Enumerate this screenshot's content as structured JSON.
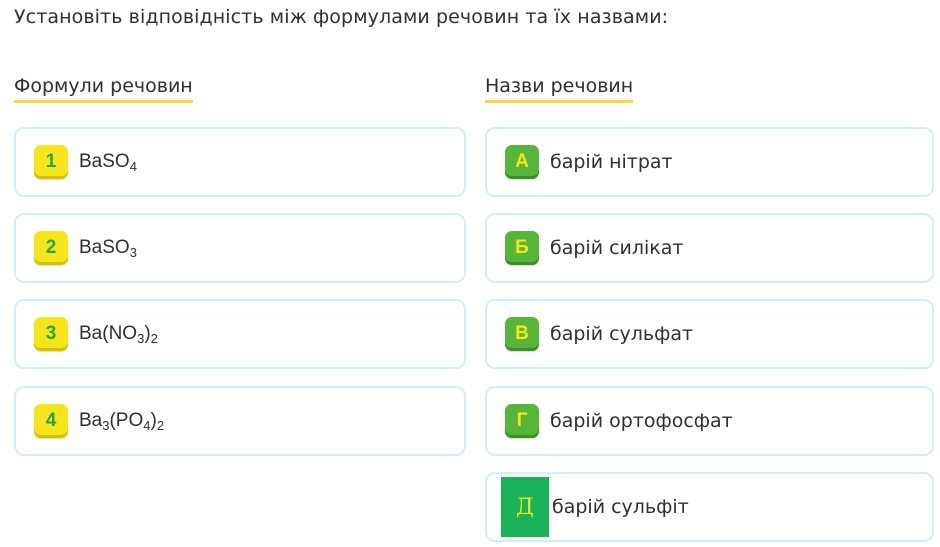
{
  "instruction": "Установіть відповідність між формулами речовин та їх назвами:",
  "left_column": {
    "title": "Формули речовин",
    "items": [
      {
        "badge": "1",
        "parts": [
          {
            "t": "BaSO"
          },
          {
            "s": "4"
          }
        ]
      },
      {
        "badge": "2",
        "parts": [
          {
            "t": "BaSO"
          },
          {
            "s": "3"
          }
        ]
      },
      {
        "badge": "3",
        "parts": [
          {
            "t": "Ba(NO"
          },
          {
            "s": "3"
          },
          {
            "t": ")"
          },
          {
            "s": "2"
          }
        ]
      },
      {
        "badge": "4",
        "parts": [
          {
            "t": "Ba"
          },
          {
            "s": "3"
          },
          {
            "t": "(PO"
          },
          {
            "s": "4"
          },
          {
            "t": ")"
          },
          {
            "s": "2"
          }
        ]
      }
    ]
  },
  "right_column": {
    "title": "Назви речовин",
    "items": [
      {
        "badge": "А",
        "label": "барій нітрат"
      },
      {
        "badge": "Б",
        "label": "барій силікат"
      },
      {
        "badge": "В",
        "label": "барій сульфат"
      },
      {
        "badge": "Г",
        "label": "барій ортофосфат"
      },
      {
        "badge": "Д",
        "label": "барій сульфіт"
      }
    ]
  },
  "colors": {
    "card_border": "#cfeefa",
    "number_badge": "#f7e51b",
    "letter_badge": "#57b53a",
    "title_underline": "#f6d94a"
  }
}
